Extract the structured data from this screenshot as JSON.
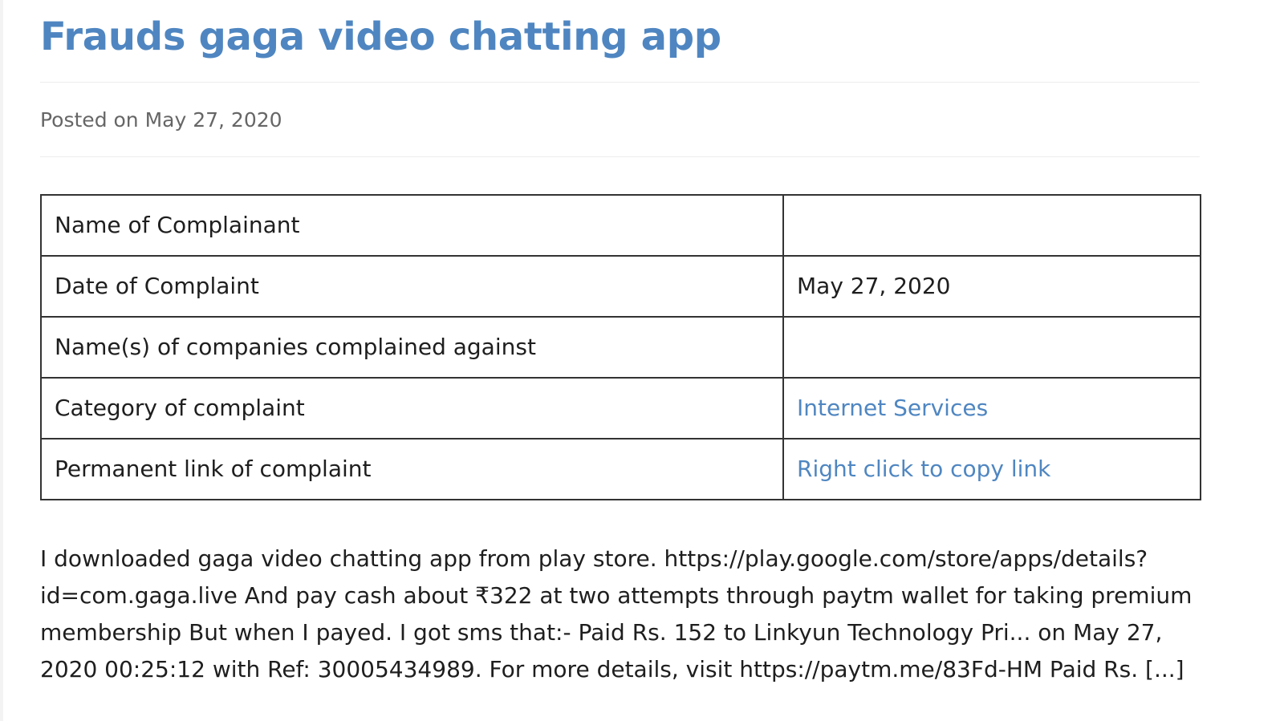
{
  "post": {
    "title": "Frauds gaga video chatting app",
    "meta": "Posted on May 27, 2020"
  },
  "table": {
    "rows": [
      {
        "label": "Name of Complainant",
        "value": ""
      },
      {
        "label": "Date of Complaint",
        "value": "May 27, 2020"
      },
      {
        "label": "Name(s) of companies complained against",
        "value": ""
      },
      {
        "label": "Category of complaint",
        "value": "Internet Services"
      },
      {
        "label": "Permanent link of complaint",
        "value": "Right click to copy link"
      }
    ]
  },
  "excerpt": {
    "lines": [
      "I downloaded gaga video chatting app from play store. https://play.google.com/store/apps/details?",
      "id=com.gaga.live And pay cash about ₹322 at two attempts through paytm wallet for taking premium",
      "membership But when I payed. I got sms that:- Paid Rs. 152 to Linkyun Technology Pri... on May 27,",
      "2020 00:25:12 with Ref: 30005434989. For more details, visit https://paytm.me/83Fd-HM Paid Rs. [...]"
    ]
  },
  "colors": {
    "accent": "#4f86c1",
    "text": "#1e1e1e",
    "meta": "#666666",
    "border": "#333333"
  }
}
